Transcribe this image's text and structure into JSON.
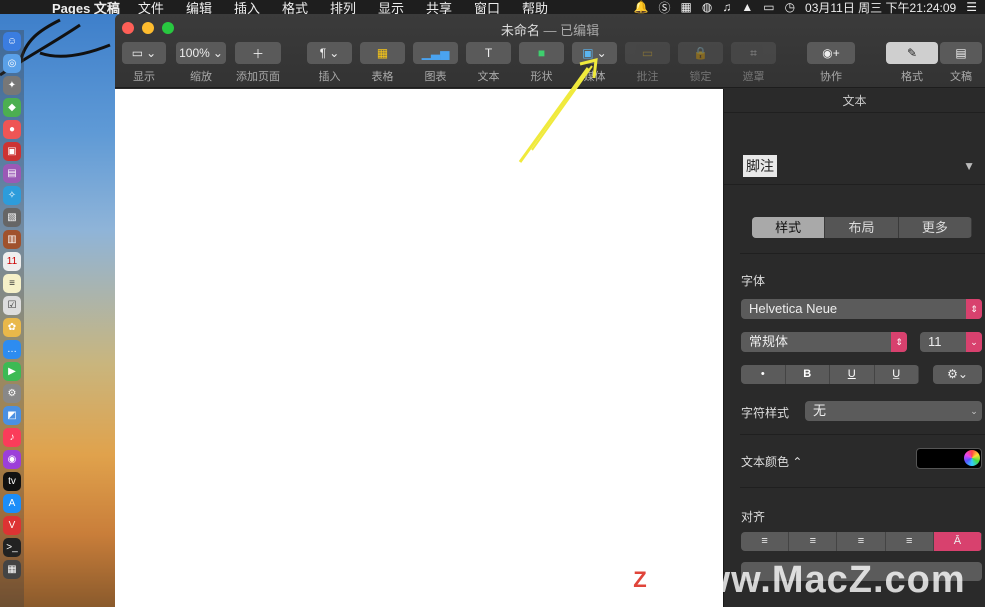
{
  "menubar": {
    "app_name": "Pages 文稿",
    "items": [
      "文件",
      "编辑",
      "插入",
      "格式",
      "排列",
      "显示",
      "共享",
      "窗口",
      "帮助"
    ],
    "datetime": "03月11日 周三 下午21:24:09"
  },
  "window": {
    "title": "未命名",
    "subtitle": "— 已编辑"
  },
  "toolbar": {
    "view_label": "显示",
    "zoom_value": "100%",
    "zoom_label": "缩放",
    "add_page_label": "添加页面",
    "insert_label": "插入",
    "table_label": "表格",
    "chart_label": "图表",
    "text_label": "文本",
    "shape_label": "形状",
    "media_label": "媒体",
    "comment_label": "批注",
    "lock_label": "锁定",
    "mask_label": "遮罩",
    "collaborate_label": "协作",
    "format_label": "格式",
    "document_label": "文稿"
  },
  "inspector": {
    "header": "文本",
    "paragraph_style": "脚注",
    "tabs": [
      "样式",
      "布局",
      "更多"
    ],
    "active_tab": "样式",
    "font_section": "字体",
    "font_family": "Helvetica Neue",
    "font_weight": "常规体",
    "font_size": "11",
    "format_buttons": [
      "•",
      "B",
      "U",
      "U̲"
    ],
    "char_style_label": "字符样式",
    "char_style_value": "无",
    "text_color_label": "文本颜色 ⌃",
    "align_section": "对齐",
    "align_buttons": [
      "≡",
      "≡",
      "≡",
      "≡",
      "Ā"
    ]
  },
  "watermark": {
    "logo": "Z",
    "text": "www.MacZ.com"
  },
  "colors": {
    "accent": "#d8416e",
    "canvas": "#ffffff",
    "arrow": "#f0ea3c"
  }
}
